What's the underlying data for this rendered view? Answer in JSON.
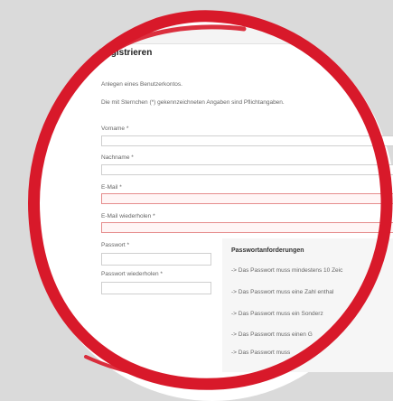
{
  "form": {
    "title": "Registrieren",
    "intro": "Anlegen eines Benutzerkontos.",
    "required_note": "Die mit Sternchen (*) gekennzeichneten Angaben sind Pflichtangaben.",
    "fields": {
      "vorname_label": "Vorname *",
      "nachname_label": "Nachname *",
      "email_label": "E-Mail *",
      "email_repeat_label": "E-Mail wiederholen *",
      "password_label": "Passwort  *",
      "password_repeat_label": "Passwort wiederholen  *"
    },
    "requirements": {
      "title": "Passwortanforderungen",
      "items": [
        "-> Das Passwort muss mindestens 10 Zeic",
        "-> Das Passwort muss eine Zahl enthal",
        "-> Das Passwort muss ein Sonderz",
        "-> Das Passwort muss einen G",
        "-> Das Passwort muss"
      ]
    }
  },
  "colors": {
    "ring": "#d8192a",
    "background": "#dadada",
    "error_border": "#e58c8c"
  }
}
